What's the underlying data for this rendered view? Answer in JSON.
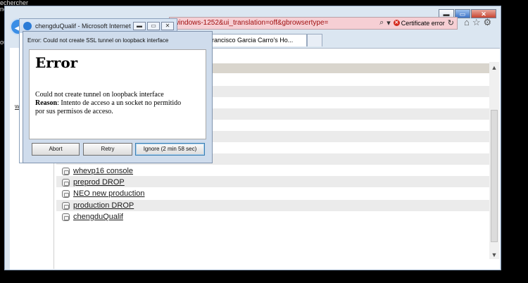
{
  "desktop": {
    "line1": "echercher",
    "line2": "ne",
    "line3": "out"
  },
  "ie": {
    "address": "windows-1252&ui_translation=off&gbrowsertype=",
    "cert_error": "Certificate error",
    "tab_title": "rancisco Garcia Carro's Ho...",
    "caption": {
      "min": "▬",
      "max": "▭",
      "close": "✕"
    },
    "icons": {
      "search": "⌕",
      "refresh": "↻",
      "home": "⌂",
      "favorites": "☆",
      "tools": "⚙"
    }
  },
  "left_strip_letter": "w",
  "links": [
    {
      "label": "whevp16 console"
    },
    {
      "label": "preprod DROP"
    },
    {
      "label": "NEO new production"
    },
    {
      "label": "production DROP"
    },
    {
      "label": "chengduQualif"
    }
  ],
  "back_window": {
    "title": "chengduQualif - Microsoft Internet ..."
  },
  "dialog": {
    "title": "Error: Could not create SSL tunnel on loopback interface",
    "heading": "Error",
    "message": "Could not create tunnel on loopback interface",
    "reason_label": "Reason",
    "reason_text": ": Intento de acceso a un socket no permitido",
    "reason_text2": "por sus permisos de acceso.",
    "buttons": {
      "abort": "Abort",
      "retry": "Retry",
      "ignore": "Ignore (2 min 58 sec)"
    }
  }
}
